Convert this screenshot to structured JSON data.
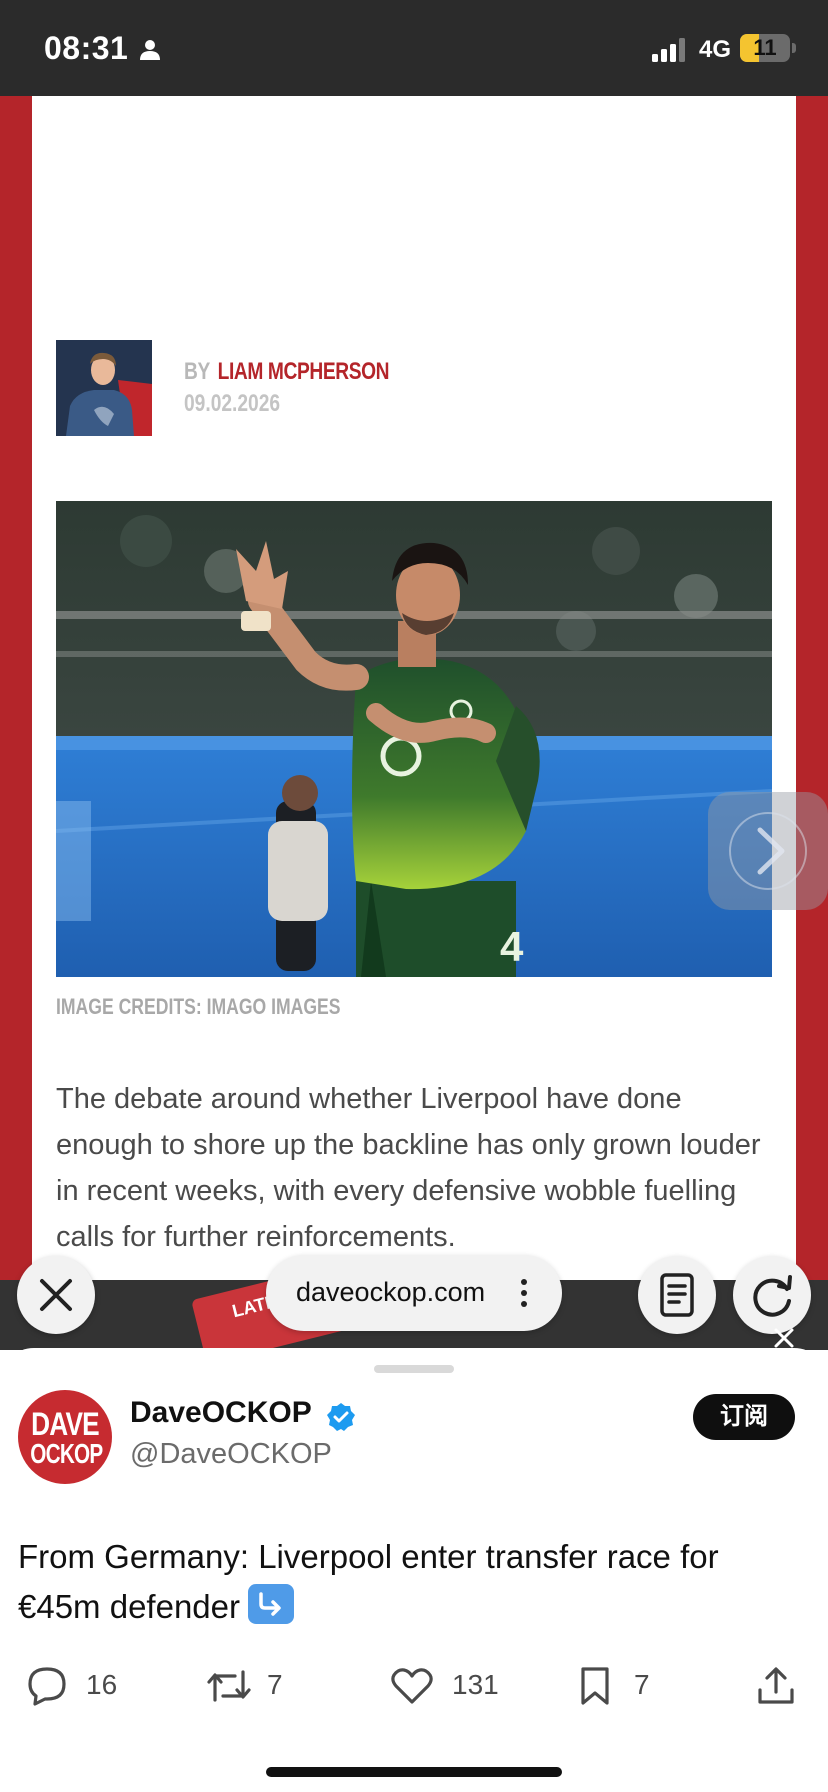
{
  "status_bar": {
    "time": "08:31",
    "network": "4G",
    "battery_level": "11",
    "battery_fraction": 0.11,
    "battery_color": "#f4c430"
  },
  "article": {
    "brand_color": "#b4252a",
    "byline_prefix": "BY",
    "author": "LIAM MCPHERSON",
    "date": "09.02.2026",
    "image_credit": "IMAGE CREDITS: IMAGO IMAGES",
    "body": "The debate around whether Liverpool have done enough to shore up the backline has only grown louder in recent weeks, with every defensive wobble fuelling calls for further reinforcements."
  },
  "browser": {
    "url": "daveockop.com",
    "thumbnail_label": "LATE"
  },
  "tweet": {
    "avatar_line1": "DAVE",
    "avatar_line2": "OCKOP",
    "display_name": "DaveOCKOP",
    "handle": "@DaveOCKOP",
    "subscribe_label": "订阅",
    "text": "From Germany: Liverpool enter transfer race for €45m defender",
    "emoji": "arrow-down-right-emoji",
    "verified_color": "#1d9bf0",
    "actions": {
      "replies": "16",
      "retweets": "7",
      "likes": "131",
      "bookmarks": "7"
    }
  },
  "icons": [
    "person-icon",
    "signal-icon",
    "close-icon",
    "more-vertical-icon",
    "reader-icon",
    "reload-icon",
    "chevron-right-icon",
    "verified-icon",
    "reply-icon",
    "retweet-icon",
    "heart-icon",
    "bookmark-icon",
    "share-icon"
  ]
}
